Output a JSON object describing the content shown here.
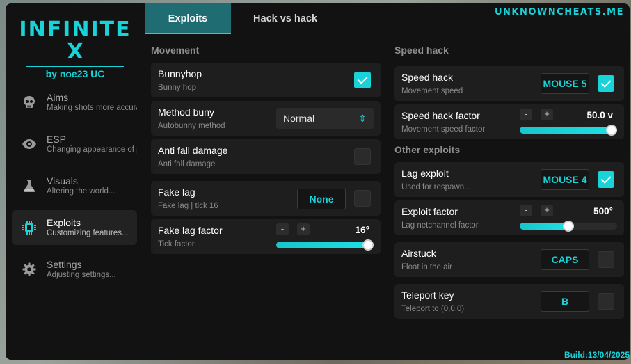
{
  "brand": "UNKNOWNCHEATS.ME",
  "build": "Build:13/04/2025",
  "logo": {
    "line1": "INFINITE",
    "line2": "X",
    "sub": "by noe23 UC"
  },
  "accent": "#19d3d8",
  "sidebar": {
    "items": [
      {
        "title": "Aims",
        "desc": "Making shots more accurate",
        "icon": "skull-icon",
        "active": false
      },
      {
        "title": "ESP",
        "desc": "Changing appearance of players",
        "icon": "eye-icon",
        "active": false
      },
      {
        "title": "Visuals",
        "desc": "Altering the world...",
        "icon": "flask-icon",
        "active": false
      },
      {
        "title": "Exploits",
        "desc": "Customizing features...",
        "icon": "chip-icon",
        "active": true
      },
      {
        "title": "Settings",
        "desc": "Adjusting settings...",
        "icon": "gear-icon",
        "active": false
      }
    ]
  },
  "tabs": [
    {
      "label": "Exploits",
      "active": true
    },
    {
      "label": "Hack vs hack",
      "active": false
    }
  ],
  "movement": {
    "title": "Movement",
    "bunnyhop": {
      "title": "Bunnyhop",
      "desc": "Bunny hop",
      "checked": true
    },
    "method_buny": {
      "title": "Method buny",
      "desc": "Autobunny method",
      "value": "Normal"
    },
    "anti_fall": {
      "title": "Anti fall damage",
      "desc": "Anti fall damage",
      "checked": false
    },
    "fake_lag": {
      "title": "Fake lag",
      "desc": "Fake lag | tick 16",
      "key": "None",
      "checked": false
    },
    "fake_lag_factor": {
      "title": "Fake lag factor",
      "desc": "Tick factor",
      "minus": "-",
      "plus": "+",
      "value_text": "16°",
      "fraction": 1.0
    }
  },
  "speed": {
    "title": "Speed hack",
    "speed_hack": {
      "title": "Speed hack",
      "desc": "Movement speed",
      "key": "MOUSE 5",
      "checked": true
    },
    "speed_factor": {
      "title": "Speed hack factor",
      "desc": "Movement speed factor",
      "minus": "-",
      "plus": "+",
      "value_text": "50.0 v",
      "fraction": 1.0
    }
  },
  "other": {
    "title": "Other exploits",
    "lag_exploit": {
      "title": "Lag exploit",
      "desc": "Used for respawn...",
      "key": "MOUSE 4",
      "checked": true
    },
    "exploit_factor": {
      "title": "Exploit factor",
      "desc": "Lag netchannel factor",
      "minus": "-",
      "plus": "+",
      "value_text": "500°",
      "fraction": 0.5
    },
    "airstuck": {
      "title": "Airstuck",
      "desc": "Float in the air",
      "key": "CAPS",
      "checked": false
    },
    "teleport": {
      "title": "Teleport key",
      "desc": "Teleport to (0,0,0)",
      "key": "B",
      "checked": false
    }
  }
}
